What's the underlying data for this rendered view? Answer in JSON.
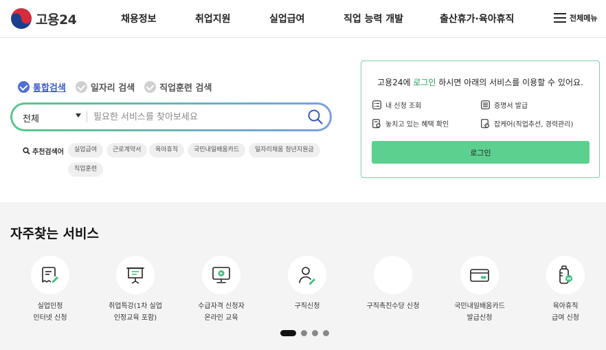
{
  "header": {
    "logo_text": "고용24",
    "nav": [
      "채용정보",
      "취업지원",
      "실업급여",
      "직업 능력 개발",
      "출산휴가·육아휴직"
    ],
    "menu_label": "전체메뉴"
  },
  "search": {
    "tabs": [
      {
        "label": "통합검색",
        "active": true
      },
      {
        "label": "일자리 검색",
        "active": false
      },
      {
        "label": "직업훈련 검색",
        "active": false
      }
    ],
    "scope": "전체",
    "placeholder": "필요한 서비스를 찾아보세요",
    "recommended_label": "추천검색어",
    "recommended": [
      "실업급여",
      "근로계약서",
      "육아휴직",
      "국민내일배움카드",
      "일자리채움 청년지원금",
      "직업훈련"
    ]
  },
  "login": {
    "msg_prefix": "고용24에 ",
    "msg_highlight": "로그인",
    "msg_suffix": " 하시면 아래의 서비스를 이용할 수 있어요.",
    "services": [
      "내 신청 조회",
      "증명서 발급",
      "놓치고 있는 혜택 확인",
      "잡케어(직업추선, 경력관리)"
    ],
    "button": "로그인"
  },
  "frequent": {
    "title": "자주찾는 서비스",
    "items": [
      {
        "line1": "실업인정",
        "line2": "인터넷 신청",
        "icon": "document-pen-icon"
      },
      {
        "line1": "취업특강(1차 실업",
        "line2": "인정교육 포함)",
        "icon": "presentation-board-icon"
      },
      {
        "line1": "수급자격 신청자",
        "line2": "온라인 교육",
        "icon": "monitor-play-icon"
      },
      {
        "line1": "구직신청",
        "line2": "",
        "icon": "person-pen-icon"
      },
      {
        "line1": "구직촉진수당 신청",
        "line2": "",
        "icon": "blank-icon"
      },
      {
        "line1": "국민내일배움카드",
        "line2": "발급신청",
        "icon": "card-icon"
      },
      {
        "line1": "육아휴직",
        "line2": "급여 신청",
        "icon": "baby-bottle-icon"
      }
    ],
    "pagination": {
      "current": 1,
      "total": 4
    }
  },
  "colors": {
    "accent_green": "#5cd08f",
    "accent_blue": "#3b5bd0",
    "border_green": "#7ccfa3"
  }
}
